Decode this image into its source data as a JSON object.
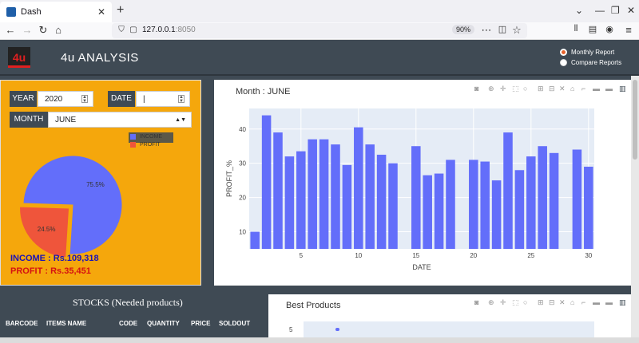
{
  "browser": {
    "tab_title": "Dash",
    "url_host": "127.0.0.1",
    "url_port": ":8050",
    "zoom": "90%"
  },
  "header": {
    "logo_text": "4u",
    "title": "4u ANALYSIS",
    "report_options": [
      "Monthly Report",
      "Compare Reports"
    ],
    "selected_report": "Monthly Report"
  },
  "filters": {
    "year_label": "YEAR",
    "year_value": "2020",
    "date_label": "DATE",
    "date_value": "",
    "month_label": "MONTH",
    "month_value": "JUNE"
  },
  "summary": {
    "income": "INCOME : Rs.109,318",
    "profit": "PROFIT : Rs.35,451"
  },
  "colors": {
    "income": "#636efa",
    "profit": "#ef553b",
    "panel": "#f5a70c",
    "bar": "#636efa"
  },
  "chart_data": [
    {
      "type": "pie",
      "labels": [
        "INCOME",
        "PROFIT"
      ],
      "values": [
        75.5,
        24.5
      ],
      "slice_labels": [
        "75.5%",
        "24.5%"
      ]
    },
    {
      "type": "bar",
      "title": "Month : JUNE",
      "xlabel": "DATE",
      "ylabel": "PROFIT_%",
      "x": [
        1,
        2,
        3,
        4,
        5,
        6,
        7,
        8,
        9,
        10,
        11,
        12,
        13,
        15,
        16,
        17,
        18,
        20,
        21,
        22,
        23,
        24,
        25,
        26,
        27,
        29,
        30
      ],
      "values": [
        10,
        44,
        39,
        32,
        33.5,
        37,
        37,
        35.5,
        29.5,
        40.5,
        35.5,
        32.5,
        30,
        35,
        26.5,
        27,
        31,
        31,
        30.5,
        25,
        39,
        28,
        32,
        35,
        33,
        34,
        29
      ],
      "xticks": [
        5,
        10,
        15,
        20,
        25,
        30
      ],
      "yticks": [
        10,
        20,
        30,
        40
      ],
      "xlim": [
        0.5,
        30.5
      ],
      "ylim": [
        5,
        46
      ],
      "grid": true
    }
  ],
  "stocks": {
    "title": "STOCKS (Needed products)",
    "columns": [
      "BARCODE",
      "ITEMS NAME",
      "CODE",
      "QUANTITY",
      "PRICE",
      "SOLDOUT"
    ]
  },
  "best_products": {
    "title": "Best Products",
    "y_tick": "5"
  }
}
